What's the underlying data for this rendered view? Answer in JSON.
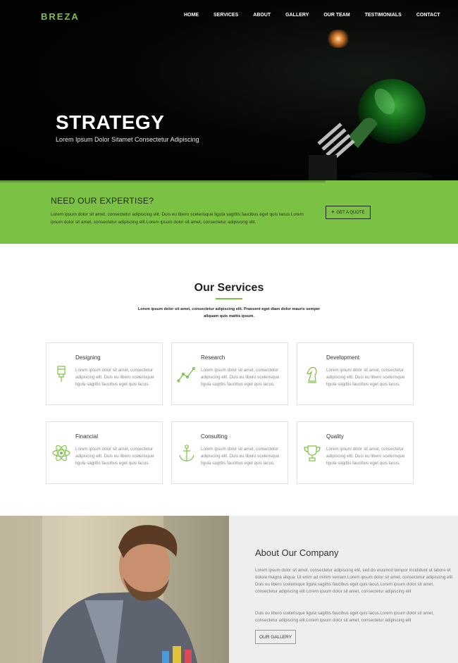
{
  "brand": {
    "logo": "BREZA",
    "accent_color": "#7bc143"
  },
  "nav": {
    "items": [
      "HOME",
      "SERVICES",
      "ABOUT",
      "GALLERY",
      "OUR TEAM",
      "TESTIMONIALS",
      "CONTACT"
    ]
  },
  "hero": {
    "title": "STRATEGY",
    "subtitle": "Lorem Ipsum Dolor Sitamet Consectetur Adipiscing"
  },
  "expertise": {
    "title": "NEED OUR EXPERTISE?",
    "text": "Lorem ipsum dolor sit amet, consectetur adipiscing elit. Duis eu libero scelerisque ligula sagittis faucibus eget quis lacus.Lorem ipsum dolor sit amet, consectetur adipiscing elit.Lorem ipsum dolor sit amet, consectetur adipiscing elit.",
    "button_label": "GET A QUOTE"
  },
  "services": {
    "title": "Our Services",
    "description": "Lorem ipsum dolor sit amet, consectetur adipiscing elit. Praesent eget diam dolor mauris semper aliquam quis mattis ipsum.",
    "cards": [
      {
        "title": "Designing",
        "icon": "paint-brush-icon",
        "text": "Lorem ipsum dolor sit amet, consectetur adipiscing elit. Duis eu libero scelerisque ligula sagittis faucibus eget quis lacus."
      },
      {
        "title": "Research",
        "icon": "line-chart-icon",
        "text": "Lorem ipsum dolor sit amet, consectetur adipiscing elit. Duis eu libero scelerisque ligula sagittis faucibus eget quis lacus."
      },
      {
        "title": "Development",
        "icon": "chess-knight-icon",
        "text": "Lorem ipsum dolor sit amet, consectetur adipiscing elit. Duis eu libero scelerisque ligula sagittis faucibus eget quis lacus."
      },
      {
        "title": "Financial",
        "icon": "atom-icon",
        "text": "Lorem ipsum dolor sit amet, consectetur adipiscing elit. Duis eu libero scelerisque ligula sagittis faucibus eget quis lacus."
      },
      {
        "title": "Consulting",
        "icon": "anchor-icon",
        "text": "Lorem ipsum dolor sit amet, consectetur adipiscing elit. Duis eu libero scelerisque ligula sagittis faucibus eget quis lacus."
      },
      {
        "title": "Quality",
        "icon": "trophy-icon",
        "text": "Lorem ipsum dolor sit amet, consectetur adipiscing elit. Duis eu libero scelerisque ligula sagittis faucibus eget quis lacus."
      }
    ]
  },
  "about": {
    "title": "About Our Company",
    "paragraph_1": "Lorem ipsum dolor sit amet, consectetur adipiscing elit, sed do eiusmod tempor incididunt ut labore et dolore magna aliqua. Ut enim ad minim veniam.Lorem ipsum dolor sit amet, consectetur adipiscing elit. Duis eu libero scelerisque ligula sagittis faucibus eget quis lacus.Lorem ipsum dolor sit amet, consectetur adipiscing elit.Lorem ipsum dolor sit amet, consectetur adipiscing elit",
    "paragraph_2": "Duis eu libero scelerisque ligula sagittis faucibus eget quis lacus.Lorem ipsum dolor sit amet, consectetur adipiscing elit.Lorem ipsum dolor sit amet, consectetur adipiscing elit",
    "button_label": "OUR GALLERY"
  }
}
